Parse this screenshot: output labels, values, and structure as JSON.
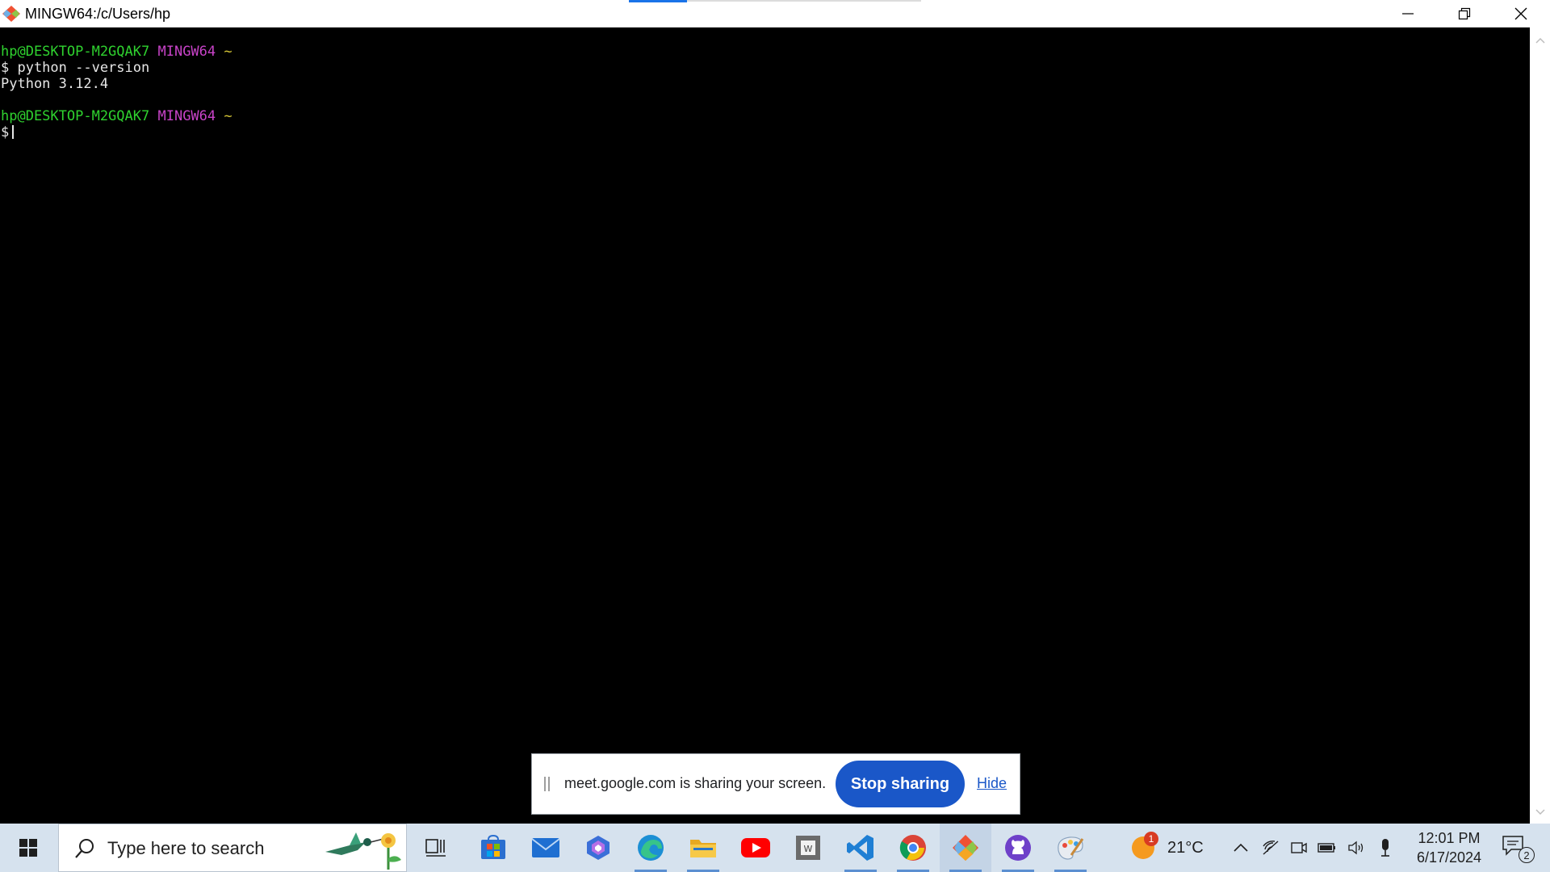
{
  "window": {
    "title": "MINGW64:/c/Users/hp"
  },
  "terminal": {
    "lines": [
      {
        "user_host": "hp@DESKTOP-M2GQAK7",
        "env": "MINGW64",
        "path": "~"
      },
      {
        "text": "$ python --version"
      },
      {
        "text": "Python 3.12.4"
      },
      {
        "text": ""
      },
      {
        "user_host": "hp@DESKTOP-M2GQAK7",
        "env": "MINGW64",
        "path": "~"
      },
      {
        "prompt": "$"
      }
    ]
  },
  "share_banner": {
    "message": "meet.google.com is sharing your screen.",
    "stop_label": "Stop sharing",
    "hide_label": "Hide"
  },
  "taskbar": {
    "search_placeholder": "Type here to search",
    "apps": [
      "task-view-icon",
      "microsoft-store-icon",
      "mail-icon",
      "copilot-icon",
      "edge-icon",
      "file-explorer-icon",
      "youtube-icon",
      "word-icon",
      "vscode-icon",
      "chrome-icon",
      "git-bash-icon",
      "github-desktop-icon",
      "paint-icon"
    ],
    "weather": {
      "temperature": "21°C",
      "badge": "1"
    },
    "clock": {
      "time": "12:01 PM",
      "date": "6/17/2024"
    },
    "notifications_count": "2"
  },
  "colors": {
    "prompt_green": "#2fd22f",
    "env_magenta": "#c843c8",
    "path_yellow": "#d6c636",
    "accent_blue": "#1a57c8"
  }
}
